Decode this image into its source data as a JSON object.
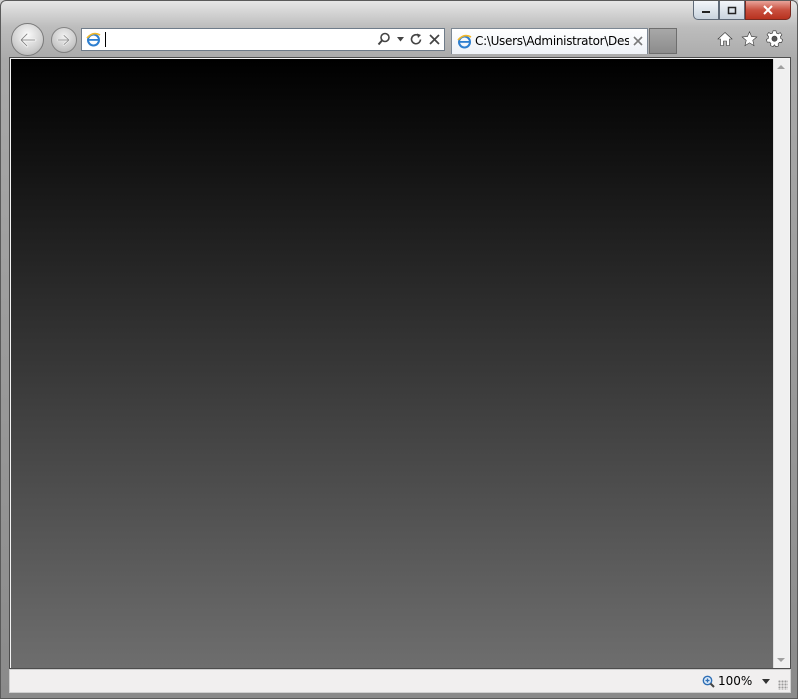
{
  "window": {
    "caption_buttons": [
      "minimize",
      "restore",
      "close"
    ]
  },
  "toolbar": {
    "back_icon": "back-arrow-icon",
    "forward_icon": "forward-arrow-icon",
    "address": {
      "value": ""
    },
    "address_tools": [
      "search-icon",
      "dropdown-icon",
      "refresh-icon",
      "stop-icon"
    ],
    "right_icons": [
      "home-icon",
      "favorites-star-icon",
      "tools-gear-icon"
    ]
  },
  "tabs": [
    {
      "title": "C:\\Users\\Administrator\\Des…",
      "active": true
    }
  ],
  "status_bar": {
    "zoom": "100%"
  },
  "colors": {
    "page_gradient_top": "#000000",
    "page_gradient_bottom": "#6e6e6e",
    "close_button": "#c9503f"
  }
}
